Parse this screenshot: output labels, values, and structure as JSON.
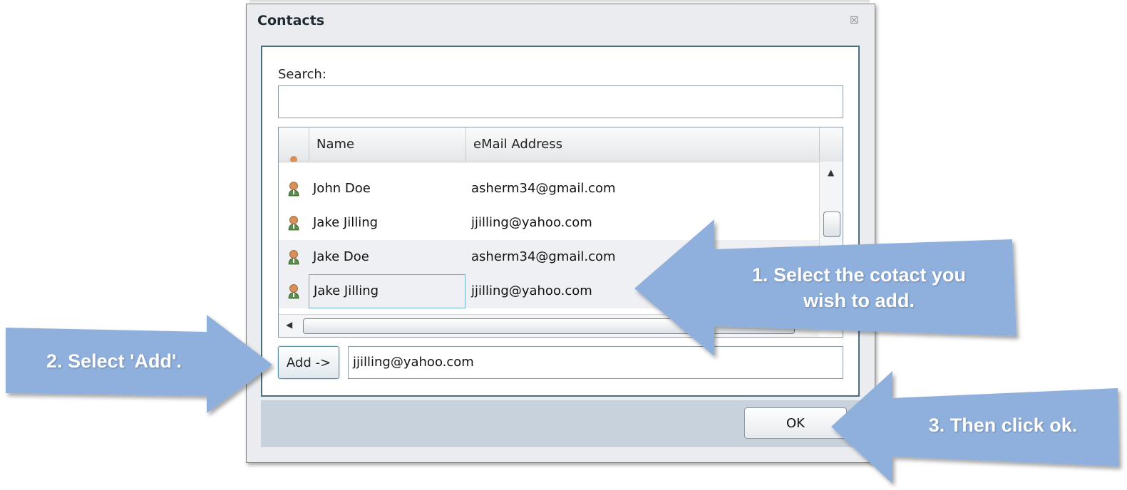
{
  "dialog": {
    "title": "Contacts",
    "close_glyph": "⊠"
  },
  "search": {
    "label": "Search:",
    "value": ""
  },
  "grid": {
    "columns": [
      "Name",
      "eMail Address"
    ],
    "rows": [
      {
        "name": "John Doe",
        "email": "asherm34@gmail.com",
        "icon": "contact-person-icon"
      },
      {
        "name": "Jake Jilling",
        "email": "jjilling@yahoo.com",
        "icon": "contact-person-icon"
      },
      {
        "name": "Jake Doe",
        "email": "asherm34@gmail.com",
        "icon": "contact-person-icon"
      },
      {
        "name": "Jake Jilling",
        "email": "jjilling@yahoo.com",
        "icon": "contact-person-icon",
        "selected": true
      }
    ],
    "scroll_up_glyph": "▲",
    "scroll_left_glyph": "◀"
  },
  "add": {
    "button_label": "Add ->",
    "added_value": "jjilling@yahoo.com"
  },
  "footer": {
    "ok_label": "OK"
  },
  "callouts": {
    "step1_line1": "1. Select the cotact you",
    "step1_line2": "wish to add.",
    "step2": "2. Select 'Add'.",
    "step3": "3. Then click ok.",
    "color": "#8fb0dd"
  }
}
